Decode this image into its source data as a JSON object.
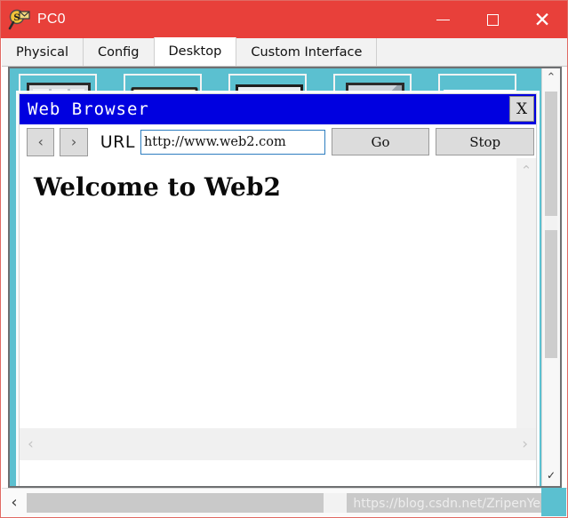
{
  "window": {
    "title": "PC0",
    "icon": "packet-tracer-icon",
    "accent_color": "#e8403a",
    "controls": {
      "minimize": "—",
      "maximize": "□",
      "close": "✕"
    }
  },
  "tabs": [
    {
      "label": "Physical",
      "active": false
    },
    {
      "label": "Config",
      "active": false
    },
    {
      "label": "Desktop",
      "active": true
    },
    {
      "label": "Custom Interface",
      "active": false
    }
  ],
  "desktop": {
    "background_color": "#5bc0d0",
    "icons": [
      {
        "name": "desktop-icon-1"
      },
      {
        "name": "desktop-icon-2"
      },
      {
        "name": "desktop-icon-3"
      },
      {
        "name": "desktop-icon-4"
      },
      {
        "name": "desktop-icon-5"
      }
    ],
    "scroll": {
      "up_arrow": "⌃",
      "down_arrow": "✓"
    }
  },
  "browser": {
    "title": "Web Browser",
    "title_bar_color": "#0000e0",
    "close_label": "X",
    "toolbar": {
      "back_label": "‹",
      "forward_label": "›",
      "url_label": "URL",
      "url_value": "http://www.web2.com",
      "url_placeholder": "http://",
      "go_label": "Go",
      "stop_label": "Stop"
    },
    "page": {
      "heading": "Welcome to Web2"
    },
    "scroll": {
      "v_up": "⌃",
      "v_down": "⌄",
      "h_left": "‹",
      "h_right": "›"
    }
  },
  "statusbar": {
    "left_arrow": "‹",
    "right_arrow": "›",
    "watermark": "https://blog.csdn.net/ZripenYe"
  }
}
